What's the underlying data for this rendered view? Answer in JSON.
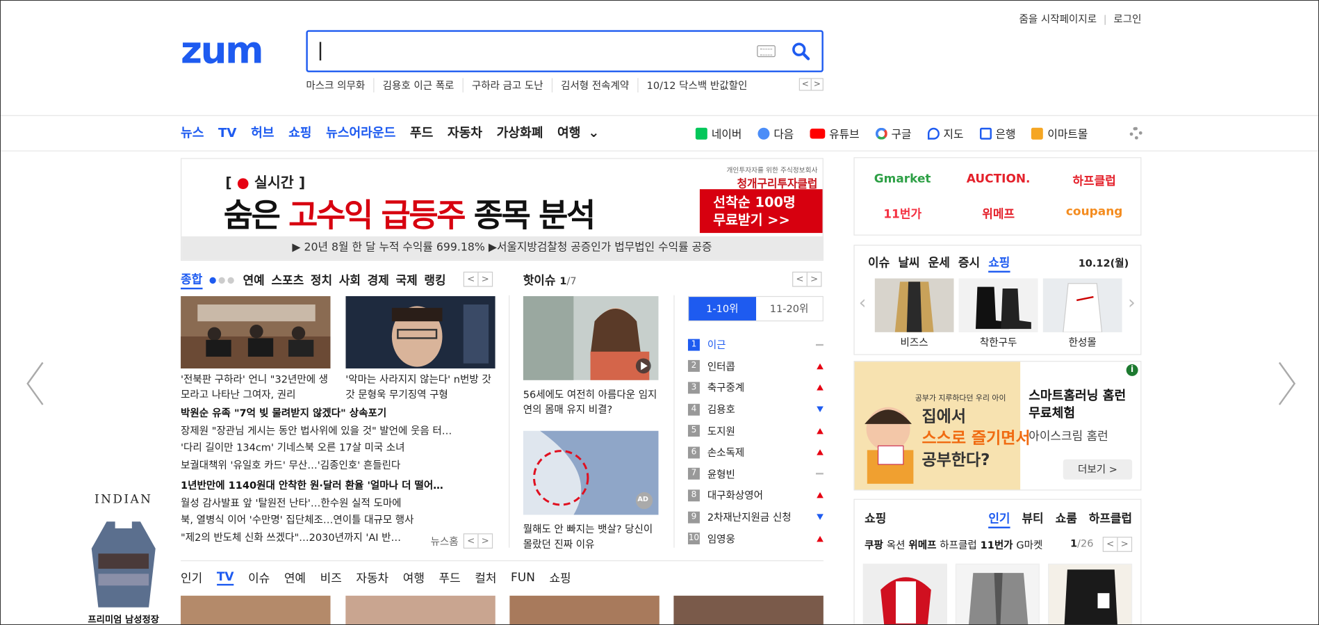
{
  "header": {
    "set_start_page": "줌을 시작페이지로",
    "separator": "|",
    "login": "로그인",
    "logo": "zum"
  },
  "search": {
    "value": "",
    "keywords": [
      "마스크 의무화",
      "김용호 이근 폭로",
      "구하라 금고 도난",
      "김서형 전속계약",
      "10/12 닥스백 반값할인"
    ],
    "prev": "<",
    "next": ">"
  },
  "gnb": {
    "items": [
      "뉴스",
      "TV",
      "허브",
      "쇼핑",
      "뉴스어라운드",
      "푸드",
      "자동차",
      "가상화폐",
      "여행"
    ],
    "more": "⌄"
  },
  "services": [
    {
      "label": "네이버",
      "icon": "naver-icon",
      "color": "#03c75a"
    },
    {
      "label": "다음",
      "icon": "daum-icon",
      "color": "#4b8df8"
    },
    {
      "label": "유튜브",
      "icon": "youtube-icon",
      "color": "#ff0000"
    },
    {
      "label": "구글",
      "icon": "google-icon",
      "color": "#4285f4"
    },
    {
      "label": "지도",
      "icon": "map-icon",
      "color": "#1e5bf0"
    },
    {
      "label": "은행",
      "icon": "bank-icon",
      "color": "#1e5bf0"
    },
    {
      "label": "이마트몰",
      "icon": "emart-icon",
      "color": "#f5a623"
    }
  ],
  "banner": {
    "live_prefix": "[",
    "live_dot": "●",
    "live": "실시간",
    "live_suffix": "]",
    "headline_pre": "숨은",
    "headline_red": "고수익 급등주",
    "headline_post": "종목 분석",
    "brand_small": "개인투자자를 위한 주식정보회사",
    "brand": "청개구리투자클럽",
    "cta_line1": "선착순 100명",
    "cta_line2": "무료받기 >>",
    "footer": "▶ 20년 8월 한 달 누적 수익률 699.18%   ▶서울지방검찰청 공증인가 법무법인 수익률 공증"
  },
  "news": {
    "tabs": [
      "종합",
      "연예",
      "스포츠",
      "정치",
      "사회",
      "경제",
      "국제",
      "랭킹"
    ],
    "active_tab": "종합",
    "dots": "●",
    "dots_off": "●●",
    "captions": [
      "'전북판 구하라' 언니 \"32년만에 생모라고 나타난 그여자, 권리",
      "'악마는 사라지지 않는다' n번방 갓갓 문형욱 무기징역 구형"
    ],
    "lines": [
      {
        "text": "박원순 유족 \"7억 빚 물려받지 않겠다\" 상속포기",
        "bold": true
      },
      {
        "text": "장제원 \"장관님 게시는 동안 법사위에 있을 것\" 발언에 웃음 터…",
        "bold": false
      },
      {
        "text": "'다리 길이만 134cm' 기네스북 오른 17살 미국 소녀",
        "bold": false
      },
      {
        "text": "보궐대책위 '유일호 카드' 무산…'김종인호' 흔들린다",
        "bold": false
      },
      {
        "text": "1년반만에 1140원대 안착한 원·달러 환율 '얼마나 더 떨어…",
        "bold": true
      },
      {
        "text": "월성 감사발표 앞 '탈원전 난타'…한수원 실적 도마에",
        "bold": false
      },
      {
        "text": "북, 열병식 이어 '수만명' 집단체조…연이틀 대규모 행사",
        "bold": false
      },
      {
        "text": "\"제2의 반도체 신화 쓰겠다\"…2030년까지 'AI 반…",
        "bold": false
      }
    ],
    "more": "뉴스홈"
  },
  "hot": {
    "title": "핫이슈",
    "page": "1",
    "total": "/7",
    "items": [
      {
        "caption": "56세에도 여전히 아름다운 임지연의 몸매 유지 비결?"
      },
      {
        "caption": "뭘해도 안 빠지는 뱃살? 당신이 몰랐던 진짜 이유"
      }
    ],
    "ad_badge": "AD"
  },
  "rank": {
    "tabs": [
      "1-10위",
      "11-20위"
    ],
    "items": [
      {
        "num": "1",
        "word": "이근",
        "trend": "same"
      },
      {
        "num": "2",
        "word": "인터콥",
        "trend": "up"
      },
      {
        "num": "3",
        "word": "축구중계",
        "trend": "up"
      },
      {
        "num": "4",
        "word": "김용호",
        "trend": "down"
      },
      {
        "num": "5",
        "word": "도지원",
        "trend": "up"
      },
      {
        "num": "6",
        "word": "손소독제",
        "trend": "up"
      },
      {
        "num": "7",
        "word": "윤형빈",
        "trend": "same"
      },
      {
        "num": "8",
        "word": "대구화상영어",
        "trend": "up"
      },
      {
        "num": "9",
        "word": "2차재난지원금 신청",
        "trend": "down"
      },
      {
        "num": "10",
        "word": "임영웅",
        "trend": "up"
      }
    ]
  },
  "bottom_tabs": [
    "인기",
    "TV",
    "이슈",
    "연예",
    "비즈",
    "자동차",
    "여행",
    "푸드",
    "컬처",
    "FUN",
    "쇼핑"
  ],
  "bottom_active": "TV",
  "shop_links": [
    {
      "label": "Gmarket",
      "color": "#2ea046"
    },
    {
      "label": "AUCTION.",
      "color": "#e4212b"
    },
    {
      "label": "하프클럽",
      "color": "#e4212b"
    },
    {
      "label": "11번가",
      "color": "#f43142"
    },
    {
      "label": "위메프",
      "color": "#e4212b"
    },
    {
      "label": "coupang",
      "color": "#f48c1f"
    }
  ],
  "issue": {
    "tabs": [
      "이슈",
      "날씨",
      "운세",
      "증시",
      "쇼핑"
    ],
    "active": "쇼핑",
    "date": "10.12(월)",
    "products": [
      "비즈스",
      "착한구두",
      "한성몰"
    ]
  },
  "ad": {
    "img_line1": "공부가 지루하다던 우리 아이",
    "img_line2": "집에서",
    "img_line3": "스스로 즐기면서",
    "img_line4": "공부한다?",
    "title": "스마트홈러닝 홈런 무료체험",
    "sub": "아이스크림 홈런",
    "more": "더보기 >",
    "info": "i"
  },
  "shopping": {
    "title": "쇼핑",
    "tabs": [
      "인기",
      "뷰티",
      "쇼룸",
      "하프클럽"
    ],
    "active": "인기",
    "subs": [
      "쿠팡",
      "옥션",
      "위메프",
      "하프클럽",
      "11번가",
      "G마켓"
    ],
    "page": "1",
    "total": "/26"
  },
  "left_ad": {
    "brand": "INDIAN",
    "caption": "프리미엄 남성정장"
  },
  "colors": {
    "accent": "#1e5bf0",
    "red": "#e60012"
  }
}
